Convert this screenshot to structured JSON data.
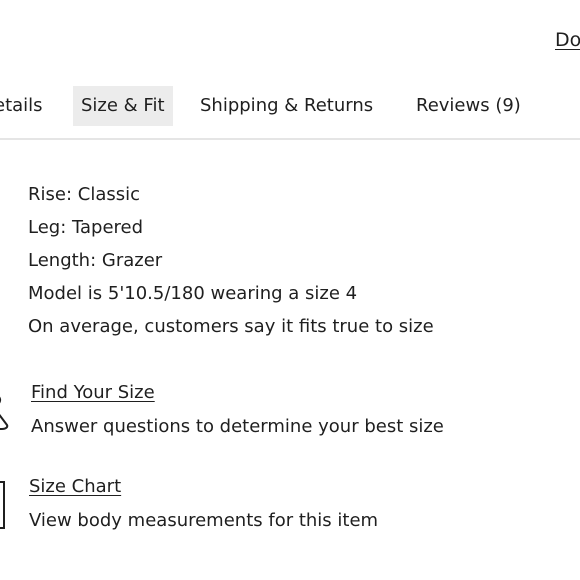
{
  "header": {
    "link_label": "Do"
  },
  "tabs": [
    {
      "label": "etails"
    },
    {
      "label": "Size & Fit"
    },
    {
      "label": "Shipping & Returns"
    },
    {
      "label": "Reviews (9)"
    }
  ],
  "fit": {
    "items": [
      "Rise: Classic",
      "Leg: Tapered",
      "Length: Grazer",
      "Model is 5'10.5/180 wearing a size 4",
      "On average, customers say it fits true to size"
    ]
  },
  "tools": {
    "find_size": {
      "title": "Find Your Size",
      "description": "Answer questions to determine your best size",
      "icon": "hanger-icon"
    },
    "size_chart": {
      "title": "Size Chart",
      "description": "View body measurements for this item",
      "icon": "chart-icon"
    }
  },
  "colors": {
    "text": "#1f1f1f",
    "active_tab_background": "#ececec",
    "divider": "#e5e5e5",
    "background": "#ffffff"
  }
}
